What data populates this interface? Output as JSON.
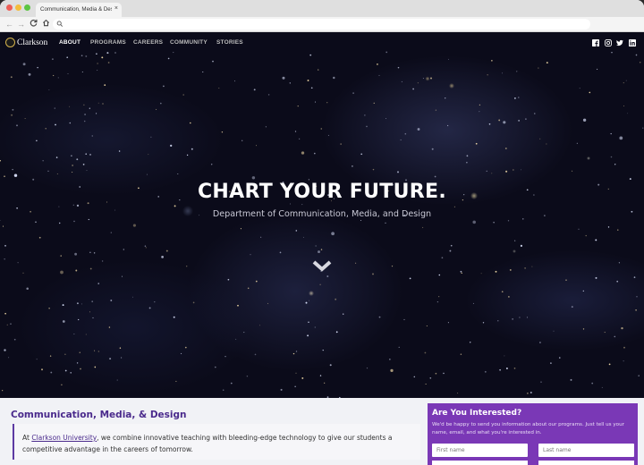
{
  "browser": {
    "tab_title": "Communication, Media & Des...",
    "tab_close": "×",
    "nav_back": "←",
    "nav_forward": "→",
    "nav_reload": "C",
    "nav_home": "⌂",
    "url_search_icon": "search-icon"
  },
  "site": {
    "logo_text": "Clarkson",
    "nav": [
      {
        "label": "ABOUT",
        "active": true
      },
      {
        "label": "PROGRAMS",
        "active": false
      },
      {
        "label": "CAREERS",
        "active": false
      },
      {
        "label": "COMMUNITY",
        "active": false
      },
      {
        "label": "STORIES",
        "active": false
      }
    ],
    "social": [
      "facebook-icon",
      "instagram-icon",
      "twitter-icon",
      "linkedin-icon"
    ]
  },
  "hero": {
    "title": "CHART YOUR FUTURE.",
    "subtitle": "Department of Communication, Media, and Design"
  },
  "intro": {
    "heading": "Communication, Media, & Design",
    "text_before": "At ",
    "link": "Clarkson University",
    "text_after": ", we combine innovative teaching with bleeding-edge technology to give our students a competitive advantage in the careers of tomorrow."
  },
  "form": {
    "title": "Are You Interested?",
    "description": "We'd be happy to send you information about our programs. Just tell us your name, email, and what you're interested in.",
    "first_placeholder": "First name",
    "last_placeholder": "Last name"
  },
  "colors": {
    "brand_purple": "#4a2a8c",
    "form_purple": "#7a38b6",
    "hero_bg": "#0b0b1a"
  }
}
